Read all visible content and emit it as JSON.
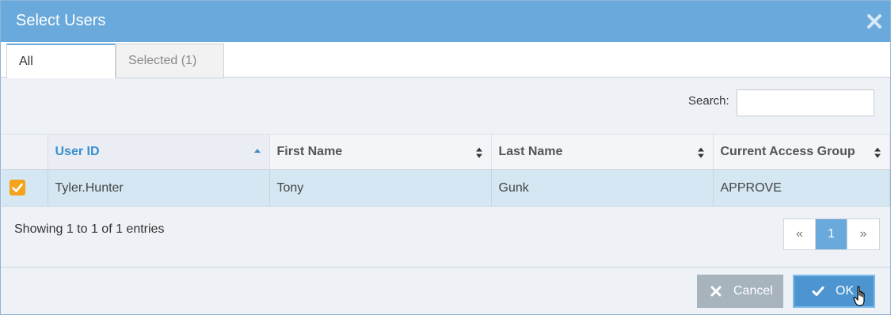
{
  "dialog": {
    "title": "Select Users",
    "close_icon": "close-icon"
  },
  "tabs": [
    {
      "label": "All",
      "active": true
    },
    {
      "label": "Selected (1)",
      "active": false
    }
  ],
  "search": {
    "label": "Search:",
    "value": "",
    "placeholder": ""
  },
  "table": {
    "columns": [
      {
        "label": "User ID",
        "sort": "ascending"
      },
      {
        "label": "First Name",
        "sort": "none"
      },
      {
        "label": "Last Name",
        "sort": "none"
      },
      {
        "label": "Current Access Group",
        "sort": "none"
      }
    ],
    "rows": [
      {
        "selected": true,
        "user_id": "Tyler.Hunter",
        "first_name": "Tony",
        "last_name": "Gunk",
        "access_group": "APPROVE"
      }
    ]
  },
  "info": "Showing 1 to 1 of 1 entries",
  "pagination": {
    "prev": "«",
    "current": "1",
    "next": "»"
  },
  "footer": {
    "cancel_label": "Cancel",
    "ok_label": "OK"
  },
  "colors": {
    "header": "#6aa9dc",
    "accent": "#3a8ed0",
    "checkbox": "#f5a31b",
    "row_selected": "#d5e7f2",
    "cancel": "#a7b4be",
    "ok": "#4d95d1"
  }
}
